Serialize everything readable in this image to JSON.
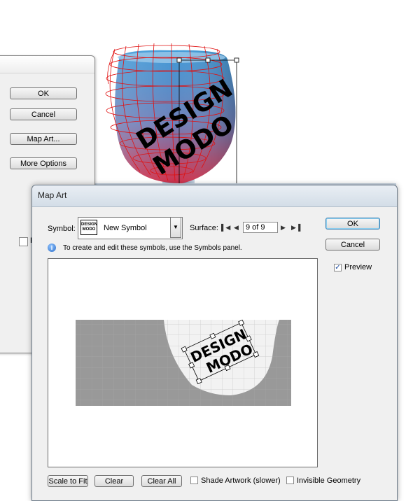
{
  "back_dialog": {
    "buttons": [
      {
        "label": "OK"
      },
      {
        "label": "Cancel"
      },
      {
        "label": "Map Art..."
      },
      {
        "label": "More Options"
      }
    ],
    "partial_checkbox_label": "Pr"
  },
  "artwork": {
    "art_text": [
      "DESIGN",
      "MODO"
    ]
  },
  "map_art": {
    "title": "Map Art",
    "symbol_label": "Symbol:",
    "symbol_thumb": [
      "DESIGN",
      "MODO"
    ],
    "symbol_value": "New Symbol",
    "surface_label": "Surface:",
    "surface_value": "9 of 9",
    "info_text": "To create and edit these symbols, use the Symbols panel.",
    "ok_label": "OK",
    "cancel_label": "Cancel",
    "preview_label": "Preview",
    "preview_checked": true,
    "surface_art_text": [
      "DESIGN",
      "MODO"
    ],
    "bottom": {
      "scale_to_fit": "Scale to Fit",
      "clear": "Clear",
      "clear_all": "Clear All",
      "shade_artwork": "Shade Artwork (slower)",
      "invisible_geometry": "Invisible Geometry"
    }
  },
  "colors": {
    "wireframe": "#e01010",
    "glass_blue": "#3a8fd0",
    "glass_pink": "#c04060",
    "surface_gray": "#999999"
  }
}
